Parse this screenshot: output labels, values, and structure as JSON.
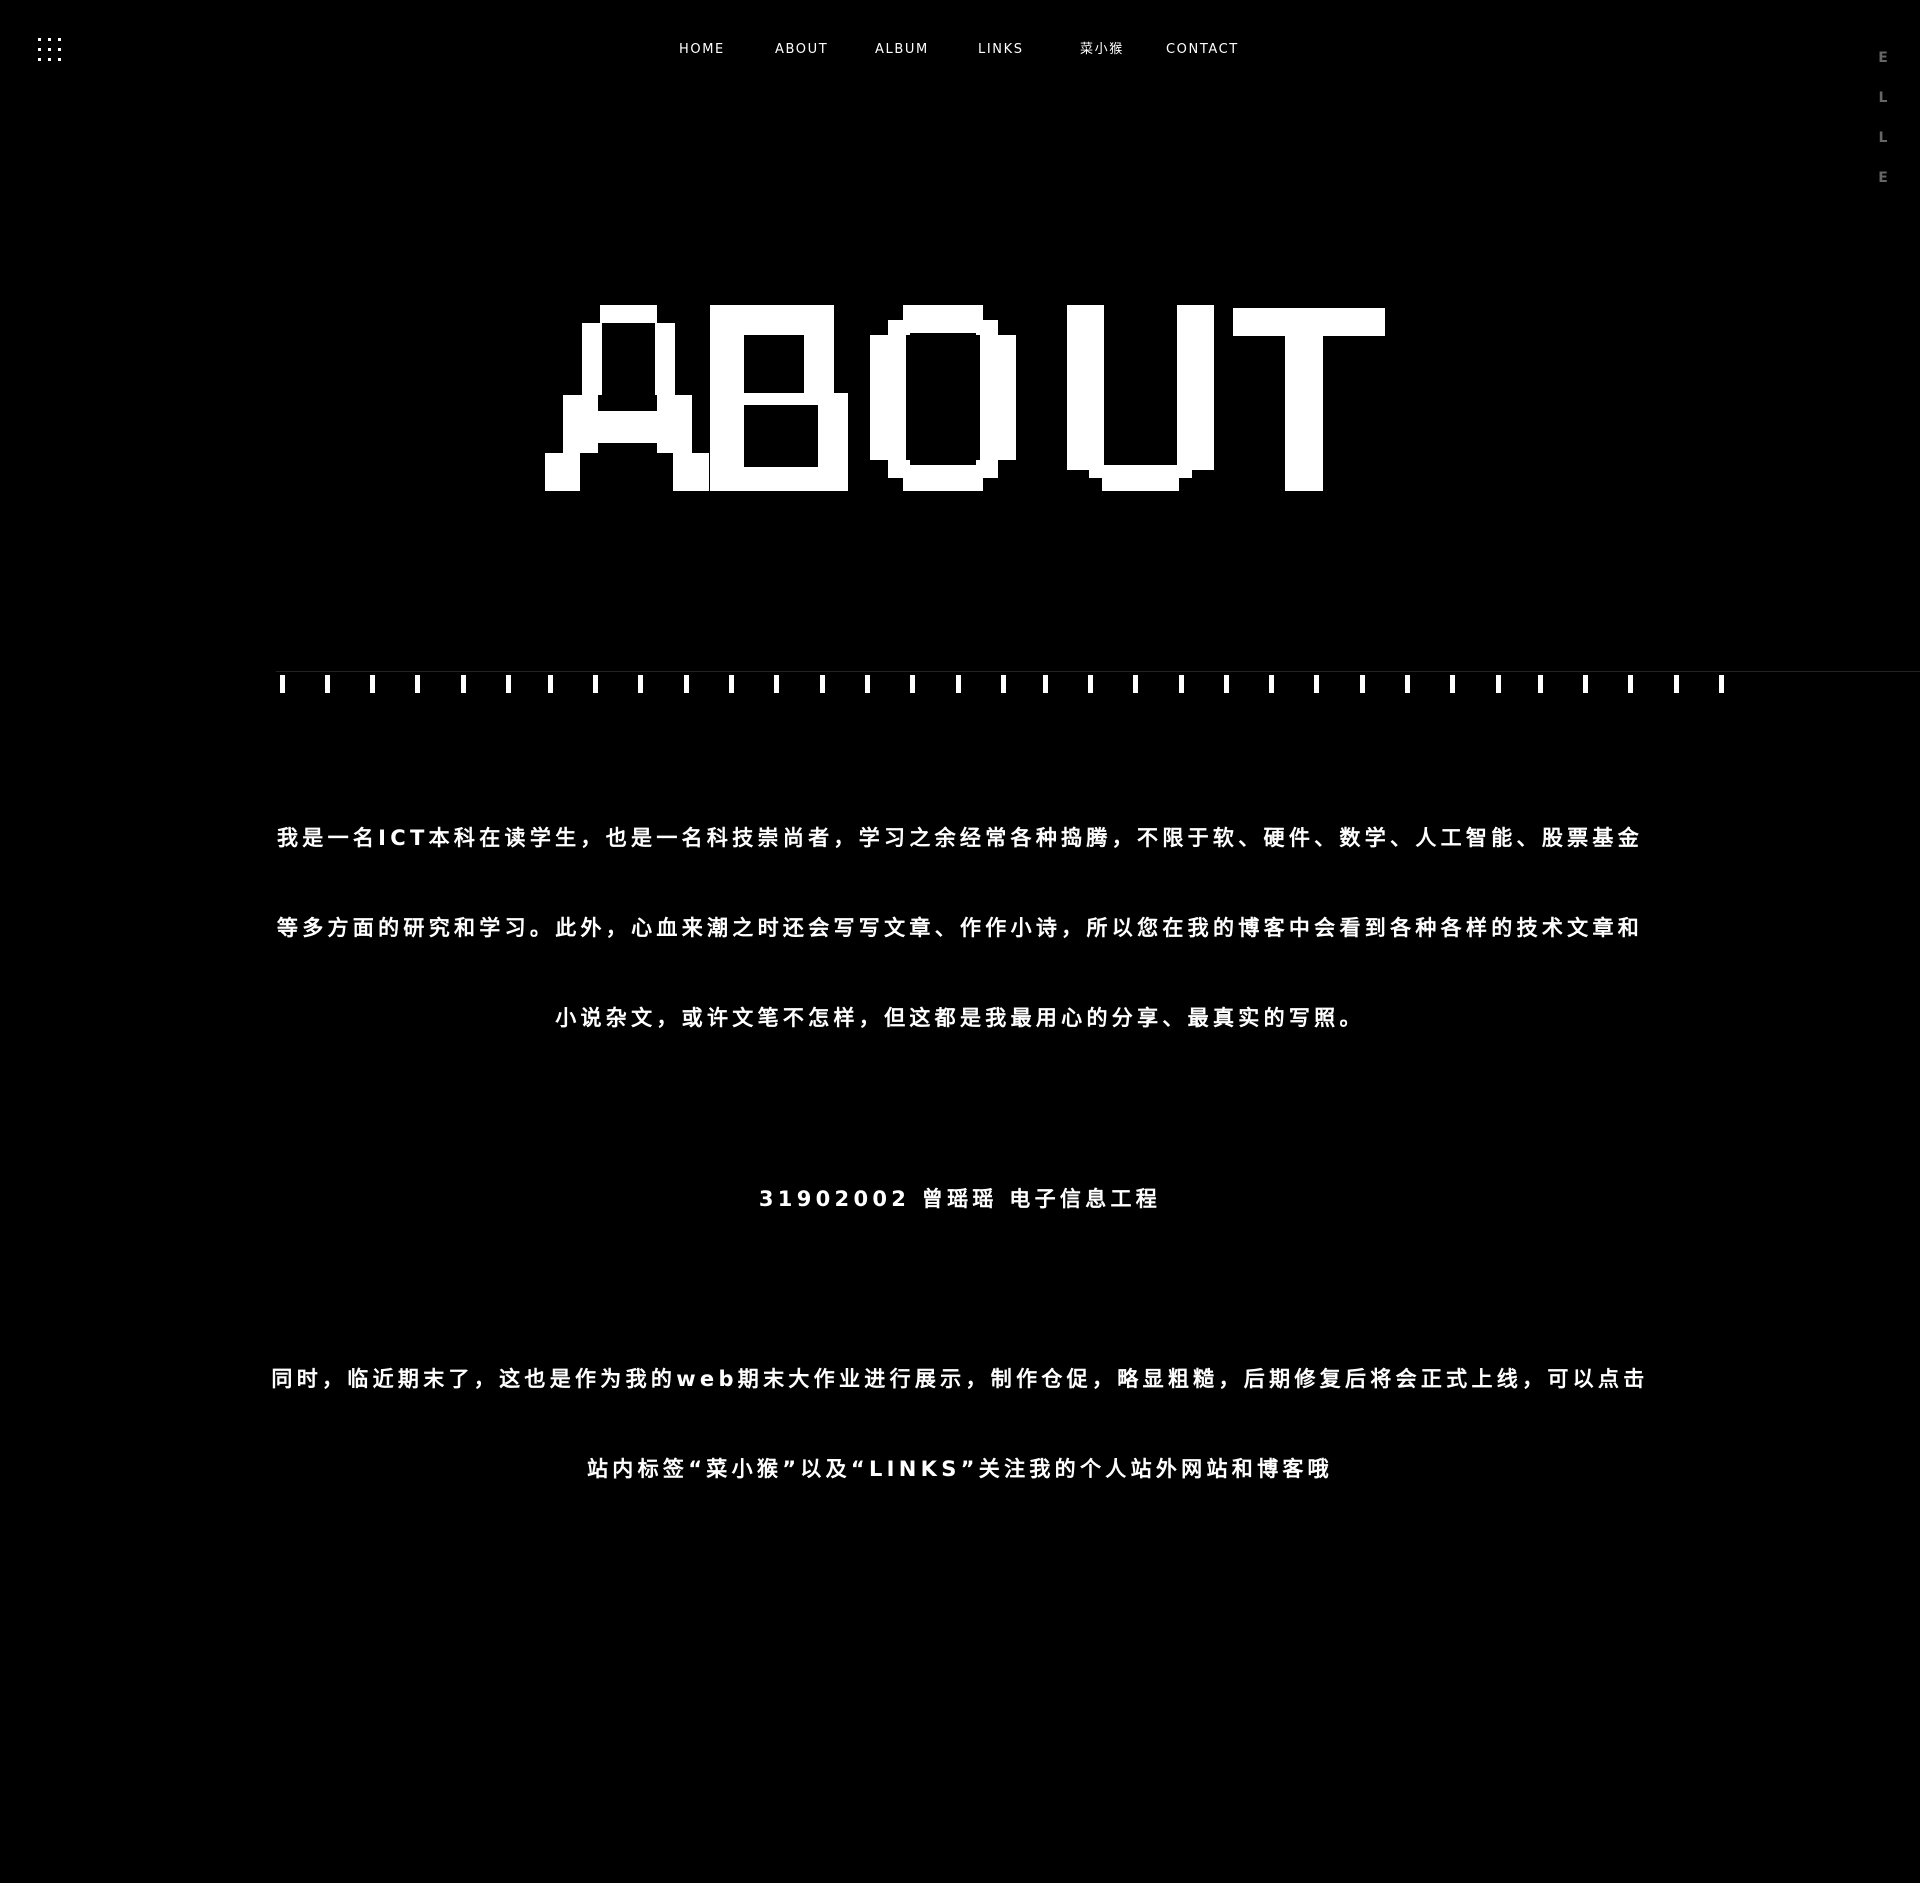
{
  "menu": {
    "icon": "grid-menu-icon"
  },
  "nav": {
    "items": [
      {
        "label": "HOME"
      },
      {
        "label": "ABOUT"
      },
      {
        "label": "ALBUM"
      },
      {
        "label": "LINKS"
      },
      {
        "label": "菜小猴"
      },
      {
        "label": "CONTACT"
      }
    ]
  },
  "side_letters": [
    "E",
    "L",
    "L",
    "E"
  ],
  "hero": {
    "title": "ABOUT"
  },
  "content": {
    "intro_lines": [
      "我是一名ICT本科在读学生，也是一名科技崇尚者，学习之余经常各种捣腾，不限于软、硬件、数学、人工智能、股票基金",
      "等多方面的研究和学习。此外，心血来潮之时还会写写文章、作作小诗，所以您在我的博客中会看到各种各样的技术文章和",
      "小说杂文，或许文笔不怎样，但这都是我最用心的分享、最真实的写照。"
    ],
    "student_info": "31902002 曾瑶瑶 电子信息工程",
    "notice_lines": [
      "同时，临近期末了，这也是作为我的web期末大作业进行展示，制作仓促，略显粗糙，后期修复后将会正式上线，可以点击",
      "站内标签“菜小猴”以及“LINKS”关注我的个人站外网站和博客哦"
    ]
  }
}
